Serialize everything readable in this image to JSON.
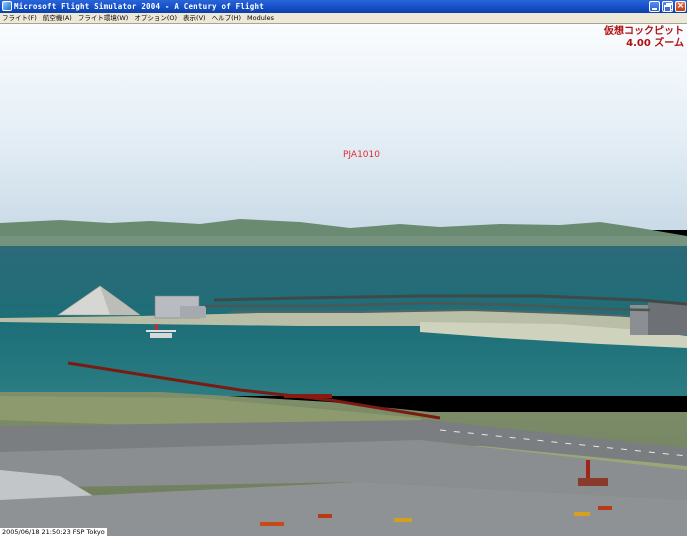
{
  "window": {
    "title": "Microsoft Flight Simulator 2004 - A Century of Flight",
    "controls": [
      "minimize",
      "maximize",
      "close"
    ]
  },
  "menu": {
    "items": [
      "フライト(F)",
      "航空機(A)",
      "フライト環境(W)",
      "オプション(O)",
      "表示(V)",
      "ヘルプ(H)",
      "Modules"
    ]
  },
  "overlay": {
    "view_mode": "仮想コックピット",
    "zoom": "4.00 ズーム",
    "aircraft_label": "PJA1010"
  },
  "status": {
    "text": "2005/06/18 21:50:23 FSP Tokyo"
  },
  "colors": {
    "view_text": "#b01010",
    "aircraft_label": "#e03030"
  }
}
